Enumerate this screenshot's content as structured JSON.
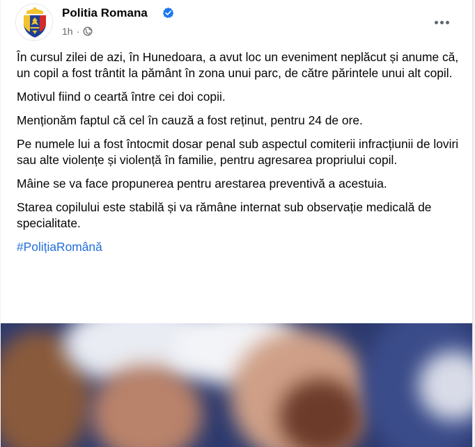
{
  "post": {
    "author": "Politia Romana",
    "time": "1h",
    "separator": "·",
    "paragraphs": [
      "În cursul zilei de azi, în Hunedoara, a avut loc un eveniment neplăcut și anume că, un copil a fost trântit la pământ în zona unui parc, de către părintele unui alt copil.",
      "Motivul fiind o ceartă între cei doi copii.",
      "Menționăm faptul că cel în cauză a fost reținut, pentru 24 de ore.",
      "Pe numele lui a fost întocmit dosar penal sub aspectul comiterii infracțiunii de loviri sau alte violențe și violență în familie, pentru agresarea propriului copil.",
      "Mâine se va face propunerea pentru arestarea preventivă a acestuia.",
      "Starea copilului este stabilă și va rămâne internat sub observație medicală de specialitate."
    ],
    "hashtag": "#PolițiaRomână"
  },
  "colors": {
    "verified_badge": "#1877f2",
    "hashtag": "#216fdb",
    "secondary_text": "#65676b"
  },
  "icons": [
    "verified-badge-icon",
    "globe-icon",
    "more-options-icon"
  ]
}
